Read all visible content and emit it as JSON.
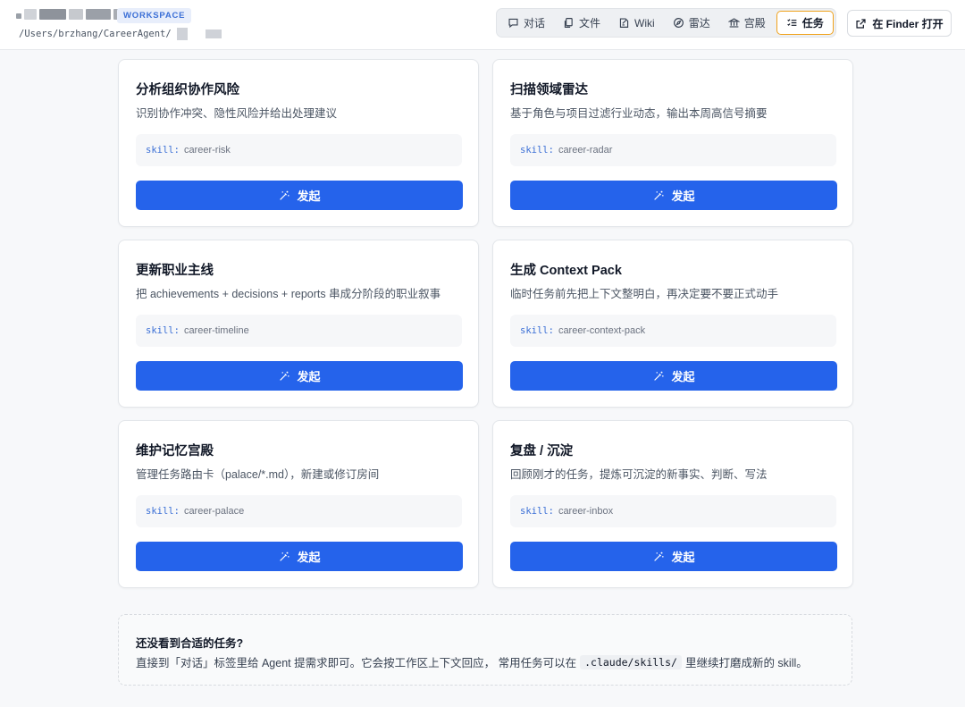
{
  "header": {
    "badge": "WORKSPACE",
    "path": "/Users/brzhang/CareerAgent/",
    "tabs": [
      {
        "label": "对话",
        "icon": "chat-icon"
      },
      {
        "label": "文件",
        "icon": "files-icon"
      },
      {
        "label": "Wiki",
        "icon": "wiki-icon"
      },
      {
        "label": "雷达",
        "icon": "radar-icon"
      },
      {
        "label": "宫殿",
        "icon": "palace-icon"
      },
      {
        "label": "任务",
        "icon": "tasks-icon",
        "active": true
      }
    ],
    "finder_label": "在 Finder 打开"
  },
  "tasks": [
    {
      "title": "分析组织协作风险",
      "desc": "识别协作冲突、隐性风险并给出处理建议",
      "skill_key": "skill:",
      "skill": "career-risk",
      "button": "发起"
    },
    {
      "title": "扫描领域雷达",
      "desc": "基于角色与项目过滤行业动态，输出本周高信号摘要",
      "skill_key": "skill:",
      "skill": "career-radar",
      "button": "发起"
    },
    {
      "title": "更新职业主线",
      "desc": "把 achievements + decisions + reports 串成分阶段的职业叙事",
      "skill_key": "skill:",
      "skill": "career-timeline",
      "button": "发起"
    },
    {
      "title": "生成 Context Pack",
      "desc": "临时任务前先把上下文整明白，再决定要不要正式动手",
      "skill_key": "skill:",
      "skill": "career-context-pack",
      "button": "发起"
    },
    {
      "title": "维护记忆宫殿",
      "desc": "管理任务路由卡（palace/*.md），新建或修订房间",
      "skill_key": "skill:",
      "skill": "career-palace",
      "button": "发起"
    },
    {
      "title": "复盘 / 沉淀",
      "desc": "回顾刚才的任务，提炼可沉淀的新事实、判断、写法",
      "skill_key": "skill:",
      "skill": "career-inbox",
      "button": "发起"
    }
  ],
  "hint": {
    "title": "还没看到合适的任务?",
    "text_before": "直接到「对话」标签里给 Agent 提需求即可。它会按工作区上下文回应， 常用任务可以在",
    "code": ".claude/skills/",
    "text_after": "里继续打磨成新的 skill。"
  },
  "colors": {
    "primary": "#2563eb",
    "active_tab_border": "#f0a21c",
    "badge_bg": "#e8eefb",
    "badge_text": "#3b6fd6"
  }
}
